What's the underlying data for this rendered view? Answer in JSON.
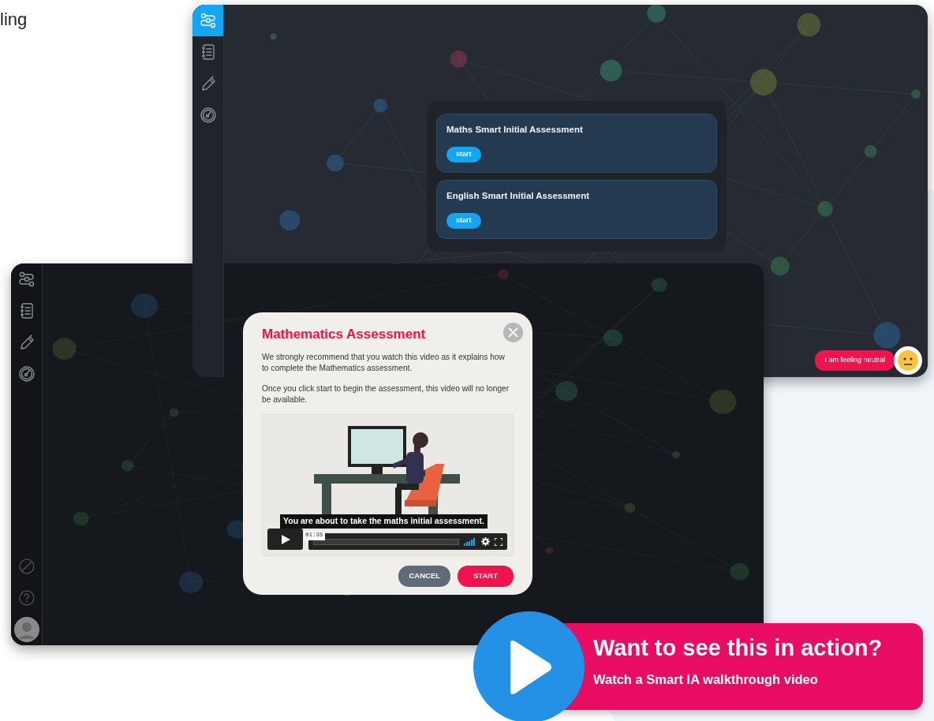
{
  "page_heading_fragment": "ling",
  "back_window": {
    "sidebar": [
      {
        "selected": true
      },
      {
        "selected": false
      },
      {
        "selected": false
      },
      {
        "selected": false
      }
    ],
    "assessments": [
      {
        "title": "Maths Smart Initial Assessment",
        "button": "start"
      },
      {
        "title": "English Smart Initial Assessment",
        "button": "start"
      }
    ],
    "mood": {
      "label": "I am feeling neutral"
    }
  },
  "front_window": {
    "sidebar": [
      {
        "selected": false
      },
      {
        "selected": false
      },
      {
        "selected": false
      },
      {
        "selected": false
      }
    ],
    "modal": {
      "title": "Mathematics Assessment",
      "paragraphs": [
        "We strongly recommend that you watch this video as it explains how to complete the Mathematics assessment.",
        "Once you click start to begin the assessment, this video will no longer be available."
      ],
      "video": {
        "caption": "You are about to take the maths initial assessment.",
        "time": "01:35"
      },
      "buttons": [
        {
          "label": "CANCEL",
          "kind": "secondary"
        },
        {
          "label": "START",
          "kind": "primary"
        }
      ]
    }
  },
  "cta": {
    "title": "Want to see this in action?",
    "subtitle": "Watch a Smart IA walkthrough video"
  }
}
